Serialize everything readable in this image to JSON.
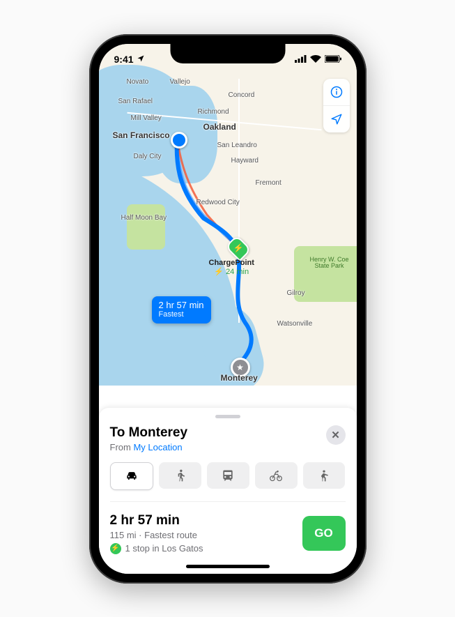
{
  "status": {
    "time": "9:41"
  },
  "map": {
    "cities": {
      "novato": "Novato",
      "vallejo": "Vallejo",
      "san_rafael": "San Rafael",
      "mill_valley": "Mill Valley",
      "san_francisco": "San Francisco",
      "daly_city": "Daly City",
      "concord": "Concord",
      "richmond": "Richmond",
      "oakland": "Oakland",
      "san_leandro": "San Leandro",
      "hayward": "Hayward",
      "fremont": "Fremont",
      "redwood_city": "Redwood City",
      "half_moon_bay": "Half Moon Bay",
      "gilroy": "Gilroy",
      "watsonville": "Watsonville",
      "monterey": "Monterey"
    },
    "park_label": "Henry W. Coe State Park",
    "charge_stop": {
      "name": "ChargePoint",
      "time": "24 min",
      "icon": "bolt-icon"
    },
    "callout": {
      "duration": "2 hr 57 min",
      "badge": "Fastest"
    },
    "controls": {
      "info": "info-icon",
      "locate": "locate-icon"
    }
  },
  "sheet": {
    "title": "To Monterey",
    "from_label": "From",
    "from_value": "My Location",
    "modes": [
      {
        "id": "drive",
        "label": "Drive",
        "selected": true
      },
      {
        "id": "walk",
        "label": "Walk",
        "selected": false
      },
      {
        "id": "transit",
        "label": "Transit",
        "selected": false
      },
      {
        "id": "cycle",
        "label": "Cycle",
        "selected": false
      },
      {
        "id": "ride",
        "label": "Ride",
        "selected": false
      }
    ],
    "route": {
      "duration": "2 hr 57 min",
      "distance": "115 mi",
      "qualifier": "Fastest route",
      "stop_text": "1 stop in Los Gatos"
    },
    "go_label": "GO",
    "close_label": "Close"
  }
}
